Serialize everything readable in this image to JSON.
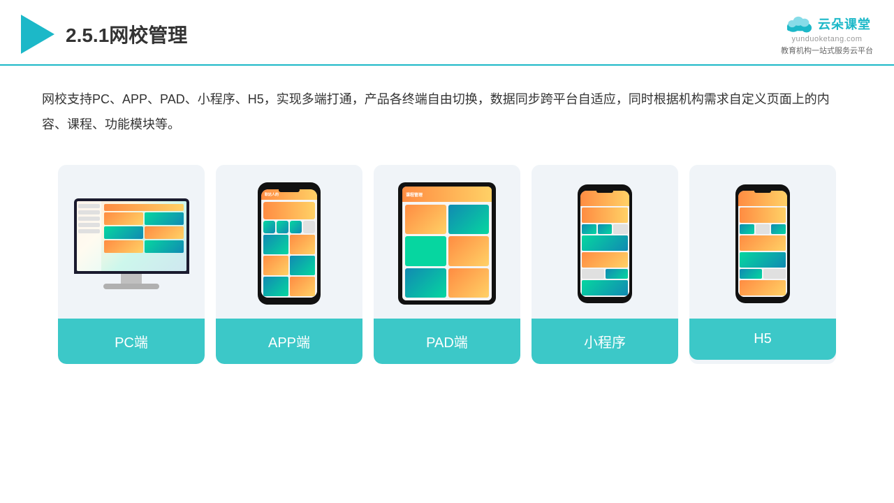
{
  "header": {
    "title": "2.5.1网校管理",
    "brand_name": "云朵课堂",
    "brand_url": "yunduoketang.com",
    "brand_slogan": "教育机构一站式服务云平台"
  },
  "description": {
    "text": "网校支持PC、APP、PAD、小程序、H5，实现多端打通，产品各终端自由切换，数据同步跨平台自适应，同时根据机构需求自定义页面上的内容、课程、功能模块等。"
  },
  "cards": [
    {
      "id": "pc",
      "label": "PC端"
    },
    {
      "id": "app",
      "label": "APP端"
    },
    {
      "id": "pad",
      "label": "PAD端"
    },
    {
      "id": "miniprogram",
      "label": "小程序"
    },
    {
      "id": "h5",
      "label": "H5"
    }
  ],
  "colors": {
    "accent": "#1cb8c8",
    "card_label_bg": "#3cc8c8"
  }
}
